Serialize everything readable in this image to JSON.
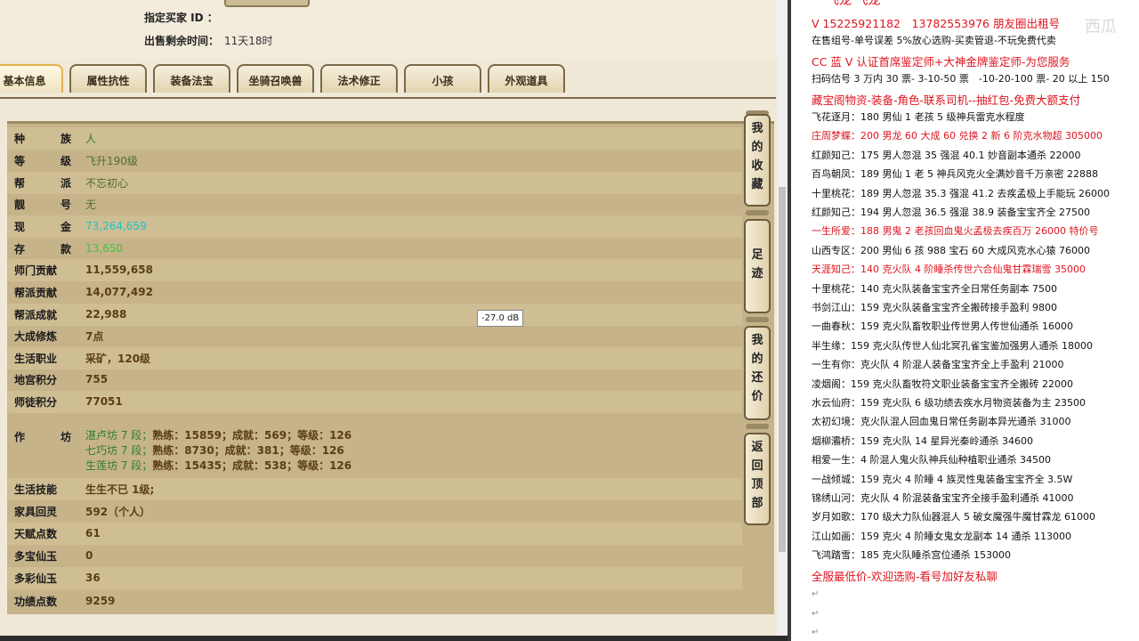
{
  "top": {
    "buyer_label": "指定买家 ID ：",
    "buyer_value": "",
    "remaining_label": "出售剩余时间：",
    "remaining_value": "11天18时"
  },
  "tabs": [
    "基本信息",
    "属性抗性",
    "装备法宝",
    "坐骑召唤兽",
    "法术修正",
    "小孩",
    "外观道具"
  ],
  "active_tab": "基本信息",
  "rows": [
    {
      "label": "种　族",
      "value": "人"
    },
    {
      "label": "等　级",
      "value": "飞升190级"
    },
    {
      "label": "帮　派",
      "value": "不忘初心"
    },
    {
      "label": "靓　号",
      "value": "无"
    },
    {
      "label": "现　金",
      "value": "73,264,659"
    },
    {
      "label": "存　款",
      "value": "13,650"
    },
    {
      "label": "师门贡献",
      "value": "11,559,658"
    },
    {
      "label": "帮派贡献",
      "value": "14,077,492"
    },
    {
      "label": "帮派成就",
      "value": "22,988"
    },
    {
      "label": "大成修炼",
      "value": "7点"
    },
    {
      "label": "生活职业",
      "value": "采矿，120级"
    },
    {
      "label": "地宫积分",
      "value": "755"
    },
    {
      "label": "师徒积分",
      "value": "77051"
    },
    {
      "label": "作　坊",
      "value": ""
    },
    {
      "label": "生活技能",
      "value": "生生不已 1级;"
    },
    {
      "label": "家具回灵",
      "value": "592（个人）"
    },
    {
      "label": "天赋点数",
      "value": "61"
    },
    {
      "label": "多宝仙玉",
      "value": "0"
    },
    {
      "label": "多彩仙玉",
      "value": "36"
    },
    {
      "label": "功绩点数",
      "value": "9259"
    }
  ],
  "workshops": [
    {
      "name": "湛卢坊 7 段；",
      "stats": "熟练：15859；成就：569；等级：126"
    },
    {
      "name": "七巧坊 7 段；",
      "stats": "熟练：8730；成就：381；等级：126"
    },
    {
      "name": "生莲坊 7 段；",
      "stats": "熟练：15435；成就：538；等级：126"
    }
  ],
  "side_buttons": [
    "我的收藏",
    "足迹",
    "我的还价",
    "返回顶部"
  ],
  "tooltip": "-27.0 dB",
  "doc_lines": [
    {
      "text": "V 15225921182　13782553976 朋友圈出租号",
      "red": true,
      "big": true
    },
    {
      "text": "在售组号-单号误差 5%放心选购-买卖管退-不玩免费代卖",
      "red": false
    },
    {
      "text": "CC 蓝 V 认证首席鉴定师+大神金牌鉴定师-为您服务",
      "red": true,
      "big": true
    },
    {
      "text": "扫码估号 3 万内 30 票- 3-10-50 票　-10-20-100 票- 20 以上 150",
      "red": false
    },
    {
      "text": "藏宝阁物资-装备-角色-联系司机--抽红包-免费大额支付",
      "red": true,
      "big": true
    },
    {
      "text": "飞花逐月：180 男仙 1 老孩 5 级神兵雷克水程度",
      "red": false
    },
    {
      "text": "庄周梦蝶：200 男龙 60 大成 60 兑换 2 新 6 阶克水物超 305000",
      "red": true
    },
    {
      "text": "红颜知己：175 男人忽混 35 强混 40.1 妙音副本通杀 22000",
      "red": false
    },
    {
      "text": "百鸟朝凤：189 男仙 1 老 5 神兵风克火全满妙音千万亲密 22888",
      "red": false
    },
    {
      "text": "十里桃花：189 男人忽混 35.3 强混 41.2 去疾孟极上手能玩 26000",
      "red": false
    },
    {
      "text": "红颜知己：194 男人忽混 36.5 强混 38.9 装备宝宝齐全 27500",
      "red": false
    },
    {
      "text": "一生所爱：188 男鬼 2 老孩回血鬼火孟极去疾百万 26000 特价号",
      "red": true
    },
    {
      "text": "山西专区：200 男仙 6 孩 988 宝石 60 大成风克水心猿 76000",
      "red": false
    },
    {
      "text": "天涯知己：140 克火队 4 阶睡杀传世六合仙鬼甘霖瑞雪 35000",
      "red": true
    },
    {
      "text": "十里桃花：140 克火队装备宝宝齐全日常任务副本 7500",
      "red": false
    },
    {
      "text": "书剑江山：159 克火队装备宝宝齐全搬砖接手盈利 9800",
      "red": false
    },
    {
      "text": "一曲春秋：159 克火队畜牧职业传世男人传世仙通杀 16000",
      "red": false
    },
    {
      "text": "半生缘：159 克火队传世人仙北冥孔雀宝鉴加强男人通杀 18000",
      "red": false
    },
    {
      "text": "一生有你：克火队 4 阶混人装备宝宝齐全上手盈利 21000",
      "red": false
    },
    {
      "text": "凌烟阁：159 克火队畜牧符文职业装备宝宝齐全搬砖 22000",
      "red": false
    },
    {
      "text": "水云仙府：159 克火队 6 级功绩去疾水月物资装备为主 23500",
      "red": false
    },
    {
      "text": "太初幻境：克火队混人回血鬼日常任务副本异光通杀 31000",
      "red": false
    },
    {
      "text": "烟柳灞桥：159 克火队 14 星异光秦岭通杀 34600",
      "red": false
    },
    {
      "text": "相爱一生：4 阶混人鬼火队神兵仙种植职业通杀 34500",
      "red": false
    },
    {
      "text": "一战倾城：159 克火 4 阶睡 4 族灵性鬼装备宝宝齐全 3.5W",
      "red": false
    },
    {
      "text": "锦绣山河：克火队 4 阶混装备宝宝齐全接手盈利通杀 41000",
      "red": false
    },
    {
      "text": "岁月如歌：170 级大力队仙器混人 5 破女魔强牛魔甘霖龙 61000",
      "red": false
    },
    {
      "text": "江山如画：159 克火 4 阶睡女鬼女龙副本 14 通杀 113000",
      "red": false
    },
    {
      "text": "飞鸿踏雪：185 克火队睡杀宫位通杀 153000",
      "red": false
    },
    {
      "text": "全服最低价-欢迎选购-看号加好友私聊",
      "red": true,
      "big": true
    }
  ],
  "cutoff_text": "飞龙 飞龙",
  "watermark": "西瓜"
}
